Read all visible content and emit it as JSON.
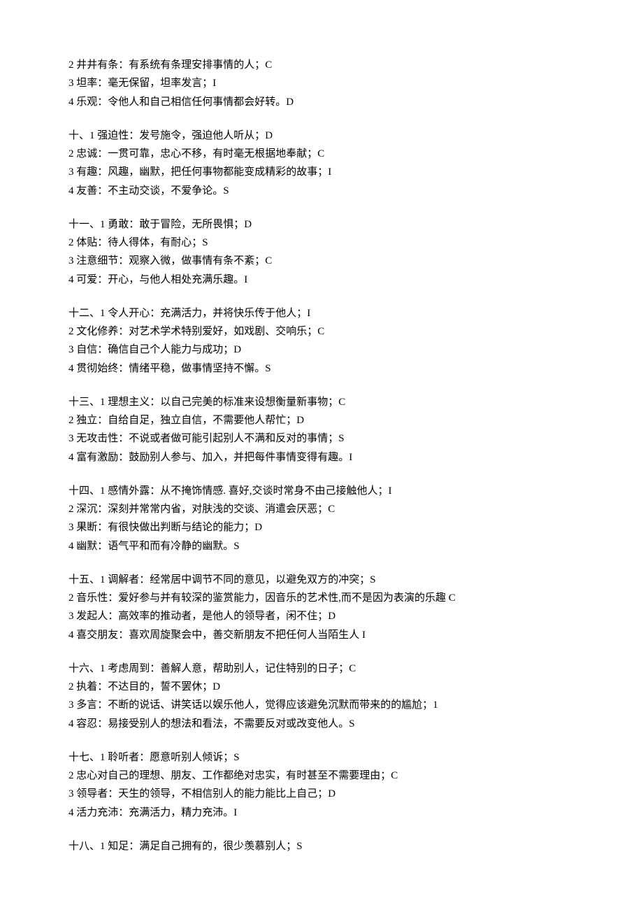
{
  "groups": [
    {
      "lines": [
        "2 井井有条：有系统有条理安排事情的人；C",
        "3 坦率：毫无保留，坦率发言；I",
        "4 乐观：令他人和自己相信任何事情都会好转。D"
      ]
    },
    {
      "lines": [
        "十、1 强迫性：发号施令，强迫他人听从；D",
        "2 忠诚：一贯可靠，忠心不移，有时毫无根据地奉献；C",
        "3 有趣：风趣，幽默，把任何事物都能变成精彩的故事；I",
        "4 友善：不主动交谈，不爱争论。S"
      ]
    },
    {
      "lines": [
        "十一、1 勇敢：敢于冒险，无所畏惧；D",
        "2 体贴：待人得体，有耐心；S",
        "3 注意细节：观察入微，做事情有条不紊；C",
        "4 可爱：开心，与他人相处充满乐趣。I"
      ]
    },
    {
      "lines": [
        "十二、1 令人开心：充满活力，并将快乐传于他人；I",
        "2 文化修养：对艺术学术特别爱好，如戏剧、交响乐；C",
        "3 自信：确信自己个人能力与成功；D",
        "4 贯彻始终：情绪平稳，做事情坚持不懈。S"
      ]
    },
    {
      "lines": [
        "十三、1 理想主义：以自己完美的标准来设想衡量新事物；C",
        "2 独立：自给自足，独立自信，不需要他人帮忙；D",
        "3 无攻击性：不说或者做可能引起别人不满和反对的事情；S",
        "4 富有激励：鼓励别人参与、加入，并把每件事情变得有趣。I"
      ]
    },
    {
      "lines": [
        "十四、1 感情外露：从不掩饰情感. 喜好,交谈时常身不由己接触他人；I",
        "2 深沉：深刻并常常内省，对肤浅的交谈、消遣会厌恶；C",
        "3 果断：有很快做出判断与结论的能力；D",
        "4 幽默：语气平和而有冷静的幽默。S"
      ]
    },
    {
      "lines": [
        "十五、1 调解者：经常居中调节不同的意见，以避免双方的冲突；S",
        "2 音乐性：爱好参与并有较深的鉴赏能力，因音乐的艺术性,而不是因为表演的乐趣 C",
        "3 发起人：高效率的推动者，是他人的领导者，闲不住；D",
        "4 喜交朋友：喜欢周旋聚会中，善交新朋友不把任何人当陌生人 I"
      ]
    },
    {
      "lines": [
        "十六、1 考虑周到：善解人意，帮助别人，记住特别的日子；C",
        "2 执着：不达目的，誓不罢休；D",
        "3 多言：不断的说话、讲笑话以娱乐他人，觉得应该避免沉默而带来的的尴尬；1",
        "4 容忍：易接受别人的想法和看法，不需要反对或改变他人。S"
      ]
    },
    {
      "lines": [
        "十七、1 聆听者：愿意听别人倾诉；S",
        "2 忠心对自己的理想、朋友、工作都绝对忠实，有时甚至不需要理由；C",
        "3 领导者：天生的领导，不相信别人的能力能比上自己；D",
        "4 活力充沛：充满活力，精力充沛。I"
      ]
    },
    {
      "lines": [
        "十八、1 知足：满足自己拥有的，很少羡慕别人；S"
      ]
    }
  ]
}
